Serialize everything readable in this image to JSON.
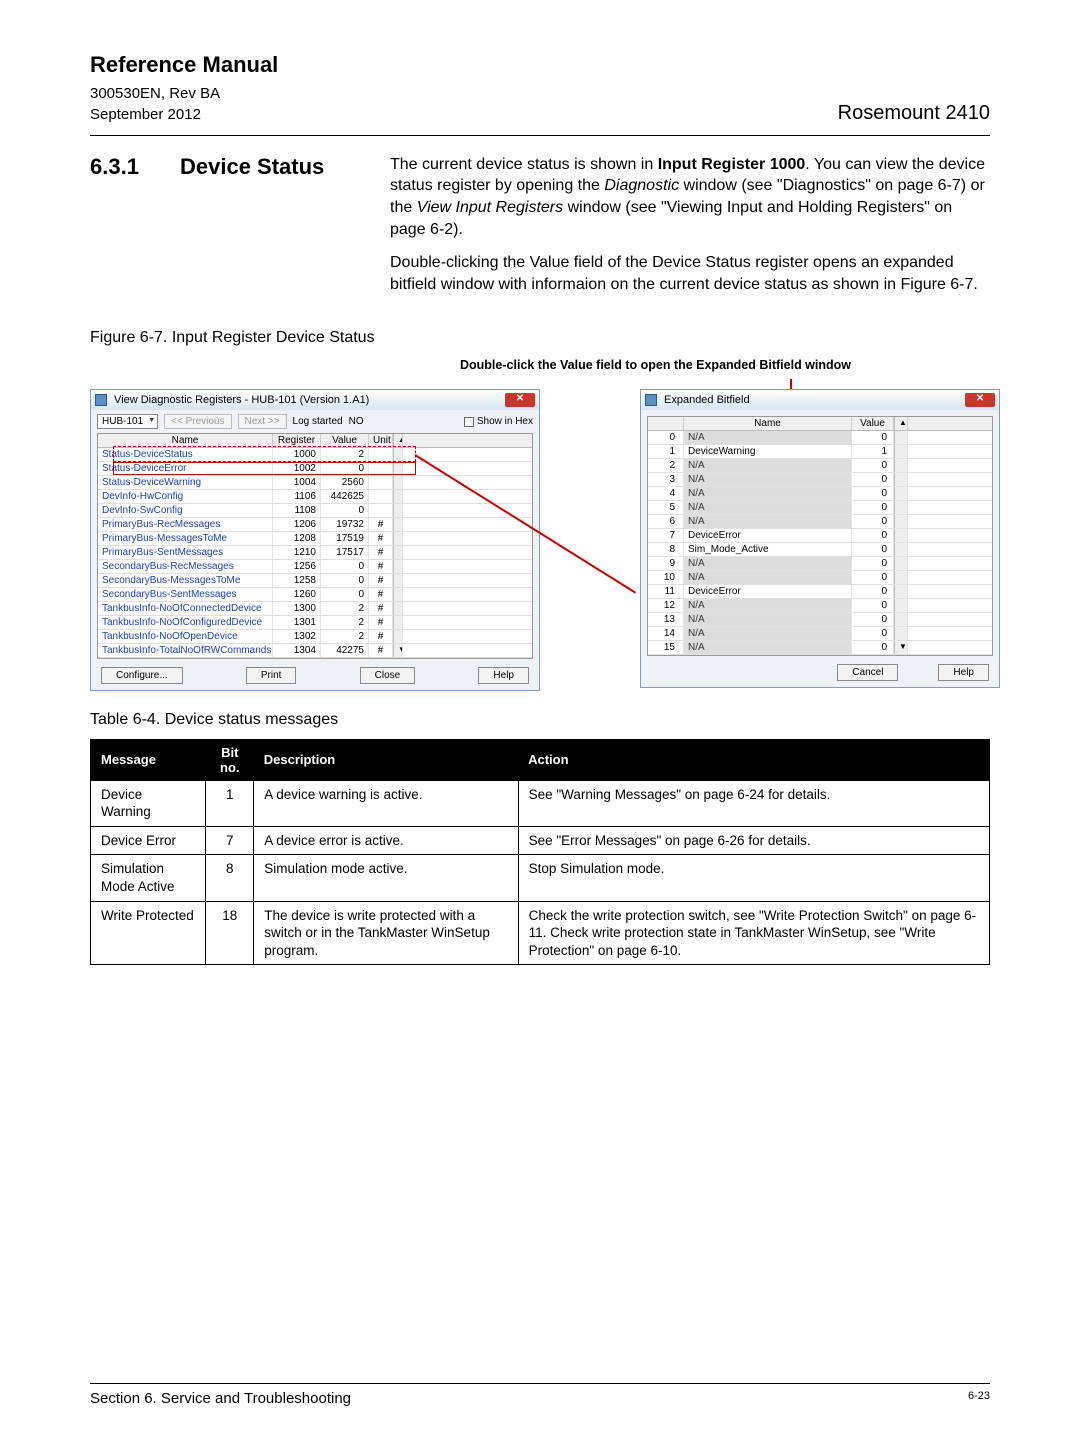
{
  "header": {
    "title": "Reference Manual",
    "doc_id": "300530EN, Rev BA",
    "date": "September 2012",
    "product": "Rosemount 2410"
  },
  "section": {
    "num": "6.3.1",
    "title": "Device Status",
    "para1_a": "The current device status is shown in ",
    "para1_b": "Input Register 1000",
    "para1_c": ". You can view the device status register by opening the ",
    "para1_d": "Diagnostic",
    "para1_e": " window (see \"Diagnostics\" on page 6-7) or the ",
    "para1_f": "View Input Registers",
    "para1_g": " window (see \"Viewing Input and Holding Registers\" on page 6-2).",
    "para2": "Double-clicking the Value field of the Device Status register opens an expanded bitfield window with informaion on the current device status as shown in Figure 6-7."
  },
  "fig_caption": "Figure 6-7. Input Register Device Status",
  "callout": "Double-click the Value field to open the Expanded Bitfield window",
  "win_left": {
    "title": "View Diagnostic Registers - HUB-101 (Version 1.A1)",
    "device_dd": "HUB-101",
    "prev": "<< Previous",
    "next": "Next >>",
    "log_label": "Log started",
    "log_value": "NO",
    "hex_label": "Show in Hex",
    "head": [
      "Name",
      "Register",
      "Value",
      "Unit",
      ""
    ],
    "rows": [
      {
        "name": "Status-DeviceStatus",
        "reg": "1000",
        "val": "2",
        "unit": ""
      },
      {
        "name": "Status-DeviceError",
        "reg": "1002",
        "val": "0",
        "unit": ""
      },
      {
        "name": "Status-DeviceWarning",
        "reg": "1004",
        "val": "2560",
        "unit": ""
      },
      {
        "name": "DevInfo-HwConfig",
        "reg": "1106",
        "val": "442625",
        "unit": ""
      },
      {
        "name": "DevInfo-SwConfig",
        "reg": "1108",
        "val": "0",
        "unit": ""
      },
      {
        "name": "PrimaryBus-RecMessages",
        "reg": "1206",
        "val": "19732",
        "unit": "#"
      },
      {
        "name": "PrimaryBus-MessagesToMe",
        "reg": "1208",
        "val": "17519",
        "unit": "#"
      },
      {
        "name": "PrimaryBus-SentMessages",
        "reg": "1210",
        "val": "17517",
        "unit": "#"
      },
      {
        "name": "SecondaryBus-RecMessages",
        "reg": "1256",
        "val": "0",
        "unit": "#"
      },
      {
        "name": "SecondaryBus-MessagesToMe",
        "reg": "1258",
        "val": "0",
        "unit": "#"
      },
      {
        "name": "SecondaryBus-SentMessages",
        "reg": "1260",
        "val": "0",
        "unit": "#"
      },
      {
        "name": "TankbusInfo-NoOfConnectedDevice",
        "reg": "1300",
        "val": "2",
        "unit": "#"
      },
      {
        "name": "TankbusInfo-NoOfConfiguredDevice",
        "reg": "1301",
        "val": "2",
        "unit": "#"
      },
      {
        "name": "TankbusInfo-NoOfOpenDevice",
        "reg": "1302",
        "val": "2",
        "unit": "#"
      },
      {
        "name": "TankbusInfo-TotalNoOfRWCommands",
        "reg": "1304",
        "val": "42275",
        "unit": "#"
      }
    ],
    "scroll_top": "▲",
    "scroll_bot": "▼",
    "buttons": [
      "Configure...",
      "Print",
      "Close",
      "Help"
    ]
  },
  "win_right": {
    "title": "Expanded Bitfield",
    "head": [
      "",
      "Name",
      "Value",
      ""
    ],
    "rows": [
      {
        "i": "0",
        "name": "N/A",
        "na": true,
        "val": "0"
      },
      {
        "i": "1",
        "name": "DeviceWarning",
        "na": false,
        "val": "1"
      },
      {
        "i": "2",
        "name": "N/A",
        "na": true,
        "val": "0"
      },
      {
        "i": "3",
        "name": "N/A",
        "na": true,
        "val": "0"
      },
      {
        "i": "4",
        "name": "N/A",
        "na": true,
        "val": "0"
      },
      {
        "i": "5",
        "name": "N/A",
        "na": true,
        "val": "0"
      },
      {
        "i": "6",
        "name": "N/A",
        "na": true,
        "val": "0"
      },
      {
        "i": "7",
        "name": "DeviceError",
        "na": false,
        "val": "0"
      },
      {
        "i": "8",
        "name": "Sim_Mode_Active",
        "na": false,
        "val": "0"
      },
      {
        "i": "9",
        "name": "N/A",
        "na": true,
        "val": "0"
      },
      {
        "i": "10",
        "name": "N/A",
        "na": true,
        "val": "0"
      },
      {
        "i": "11",
        "name": "DeviceError",
        "na": false,
        "val": "0"
      },
      {
        "i": "12",
        "name": "N/A",
        "na": true,
        "val": "0"
      },
      {
        "i": "13",
        "name": "N/A",
        "na": true,
        "val": "0"
      },
      {
        "i": "14",
        "name": "N/A",
        "na": true,
        "val": "0"
      },
      {
        "i": "15",
        "name": "N/A",
        "na": true,
        "val": "0"
      }
    ],
    "scroll_top": "▲",
    "scroll_bot": "▼",
    "buttons": [
      "Cancel",
      "Help"
    ]
  },
  "table_caption": "Table 6-4.  Device status messages",
  "table_head": [
    "Message",
    "Bit no.",
    "Description",
    "Action"
  ],
  "table_rows": [
    {
      "msg": "Device Warning",
      "bit": "1",
      "desc": "A device warning is active.",
      "act": "See \"Warning Messages\" on page 6-24 for details."
    },
    {
      "msg": "Device Error",
      "bit": "7",
      "desc": "A device error is active.",
      "act": "See \"Error Messages\" on page 6-26 for details."
    },
    {
      "msg": "Simulation Mode Active",
      "bit": "8",
      "desc": "Simulation mode active.",
      "act": "Stop Simulation mode."
    },
    {
      "msg": "Write Protected",
      "bit": "18",
      "desc": "The device is write protected with a switch or in the TankMaster WinSetup program.",
      "act": "Check the write protection switch, see \"Write Protection Switch\" on page 6-11. Check write protection state in TankMaster WinSetup, see \"Write Protection\" on page 6-10."
    }
  ],
  "footer": {
    "left": "Section 6. Service and Troubleshooting",
    "right": "6-23"
  }
}
